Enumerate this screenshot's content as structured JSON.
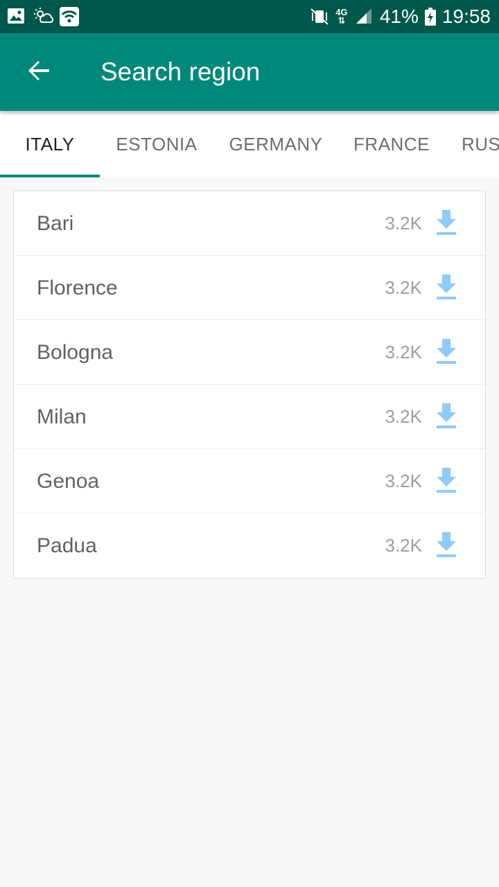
{
  "status_bar": {
    "left_icons": [
      "image-icon",
      "weather-icon",
      "wifi-icon"
    ],
    "network": [
      "4G",
      "⇅"
    ],
    "battery": "41%",
    "time": "19:58"
  },
  "app_bar": {
    "title": "Search region",
    "back_icon": "arrow-back-icon"
  },
  "tabs": [
    {
      "label": "ITALY",
      "active": true
    },
    {
      "label": "ESTONIA",
      "active": false
    },
    {
      "label": "GERMANY",
      "active": false
    },
    {
      "label": "FRANCE",
      "active": false
    },
    {
      "label": "RUS",
      "active": false
    }
  ],
  "regions": [
    {
      "name": "Bari",
      "size": "3.2K",
      "icon": "download-icon"
    },
    {
      "name": "Florence",
      "size": "3.2K",
      "icon": "download-icon"
    },
    {
      "name": "Bologna",
      "size": "3.2K",
      "icon": "download-icon"
    },
    {
      "name": "Milan",
      "size": "3.2K",
      "icon": "download-icon"
    },
    {
      "name": "Genoa",
      "size": "3.2K",
      "icon": "download-icon"
    },
    {
      "name": "Padua",
      "size": "3.2K",
      "icon": "download-icon"
    }
  ],
  "colors": {
    "status_bar": "#00574b",
    "primary": "#00897b",
    "download_icon": "#90caf9"
  }
}
